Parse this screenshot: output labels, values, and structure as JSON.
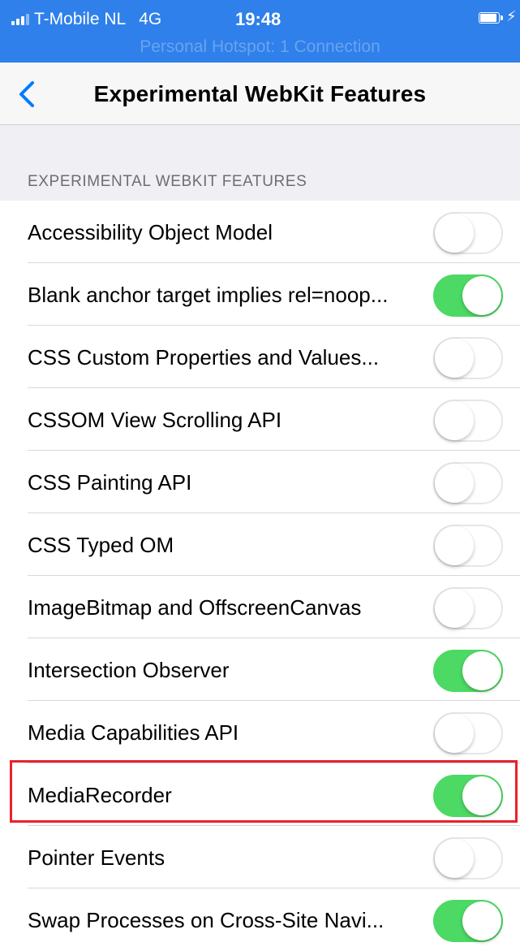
{
  "status_bar": {
    "carrier": "T-Mobile NL",
    "network": "4G",
    "time": "19:48",
    "hotspot": "Personal Hotspot: 1 Connection",
    "battery_icon": "battery-icon",
    "charging_icon": "bolt-icon"
  },
  "nav": {
    "title": "Experimental WebKit Features",
    "back_icon": "chevron-left-icon"
  },
  "section": {
    "header": "EXPERIMENTAL WEBKIT FEATURES"
  },
  "items": [
    {
      "label": "Accessibility Object Model",
      "enabled": false
    },
    {
      "label": "Blank anchor target implies rel=noop...",
      "enabled": true
    },
    {
      "label": "CSS Custom Properties and Values...",
      "enabled": false
    },
    {
      "label": "CSSOM View Scrolling API",
      "enabled": false
    },
    {
      "label": "CSS Painting API",
      "enabled": false
    },
    {
      "label": "CSS Typed OM",
      "enabled": false
    },
    {
      "label": "ImageBitmap and OffscreenCanvas",
      "enabled": false
    },
    {
      "label": "Intersection Observer",
      "enabled": true
    },
    {
      "label": "Media Capabilities API",
      "enabled": false
    },
    {
      "label": "MediaRecorder",
      "enabled": true,
      "highlighted": true
    },
    {
      "label": "Pointer Events",
      "enabled": false
    },
    {
      "label": "Swap Processes on Cross-Site Navi...",
      "enabled": true
    }
  ],
  "colors": {
    "status_bar": "#2f80ea",
    "toggle_on": "#4cd964",
    "highlight": "#e8222b",
    "accent": "#007aff"
  }
}
